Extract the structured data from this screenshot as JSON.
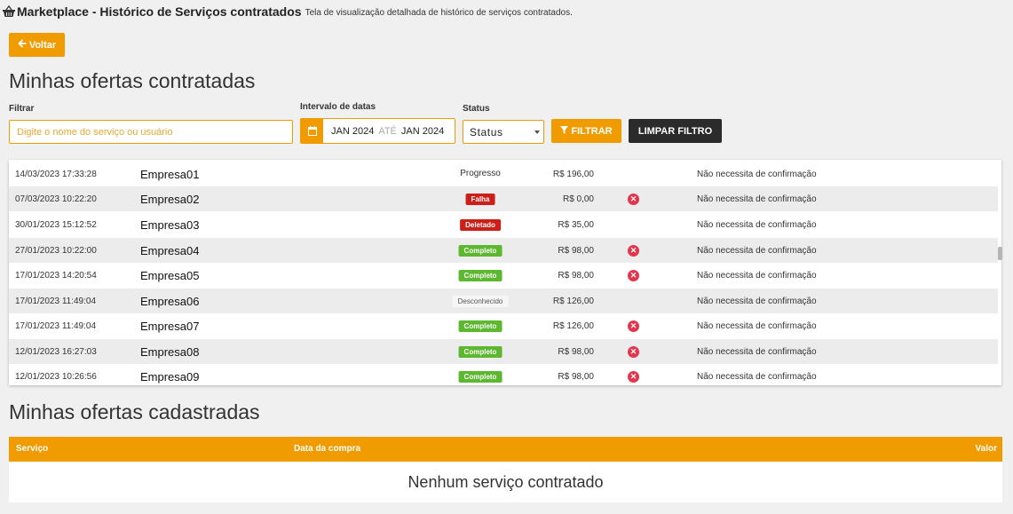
{
  "header": {
    "title": "Marketplace - Histórico de Serviços contratados",
    "subtitle": "Tela de visualização detalhada de histórico de serviços contratados.",
    "basket_icon": "basket-icon"
  },
  "back_button": {
    "label": "Voltar",
    "icon": "arrow-left-icon"
  },
  "contracted": {
    "heading": "Minhas ofertas contratadas",
    "filter_label": "Filtrar",
    "search_placeholder": "Digite o nome do serviço ou usuário",
    "date_label": "Intervalo de datas",
    "date_from": "JAN 2024",
    "date_sep": "ATÉ",
    "date_to": "JAN 2024",
    "status_label": "Status",
    "status_value": "Status",
    "filter_button": "FILTRAR",
    "clear_button": "LIMPAR FILTRO"
  },
  "rows": [
    {
      "date": "14/03/2023 17:33:28",
      "company": "Empresa01",
      "status": "Progresso",
      "value": "R$ 196,00",
      "cancel": false,
      "confirmation": "Não necessita de confirmação"
    },
    {
      "date": "07/03/2023 10:22:20",
      "company": "Empresa02",
      "status": "Falha",
      "value": "R$ 0,00",
      "cancel": true,
      "confirmation": "Não necessita de confirmação"
    },
    {
      "date": "30/01/2023 15:12:52",
      "company": "Empresa03",
      "status": "Deletado",
      "value": "R$ 35,00",
      "cancel": false,
      "confirmation": "Não necessita de confirmação"
    },
    {
      "date": "27/01/2023 10:22:00",
      "company": "Empresa04",
      "status": "Completo",
      "value": "R$ 98,00",
      "cancel": true,
      "confirmation": "Não necessita de confirmação"
    },
    {
      "date": "17/01/2023 14:20:54",
      "company": "Empresa05",
      "status": "Completo",
      "value": "R$ 98,00",
      "cancel": true,
      "confirmation": "Não necessita de confirmação"
    },
    {
      "date": "17/01/2023 11:49:04",
      "company": "Empresa06",
      "status": "Desconhecido",
      "value": "R$ 126,00",
      "cancel": false,
      "confirmation": "Não necessita de confirmação"
    },
    {
      "date": "17/01/2023 11:49:04",
      "company": "Empresa07",
      "status": "Completo",
      "value": "R$ 126,00",
      "cancel": true,
      "confirmation": "Não necessita de confirmação"
    },
    {
      "date": "12/01/2023 16:27:03",
      "company": "Empresa08",
      "status": "Completo",
      "value": "R$ 98,00",
      "cancel": true,
      "confirmation": "Não necessita de confirmação"
    },
    {
      "date": "12/01/2023 10:26:56",
      "company": "Empresa09",
      "status": "Completo",
      "value": "R$ 98,00",
      "cancel": true,
      "confirmation": "Não necessita de confirmação"
    }
  ],
  "registered": {
    "heading": "Minhas ofertas cadastradas",
    "col_service": "Serviço",
    "col_date": "Data da compra",
    "col_value": "Valor",
    "empty_text": "Nenhum serviço contratado"
  },
  "colors": {
    "accent": "#f09c00",
    "dark": "#2b2b2b",
    "danger": "#cc1f1a",
    "success": "#5cb82f",
    "cancel": "#e5354d"
  }
}
